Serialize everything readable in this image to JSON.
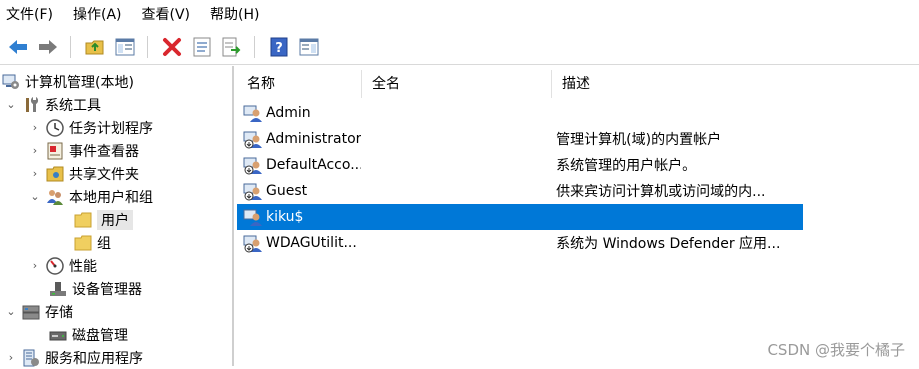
{
  "menu": [
    "文件(F)",
    "操作(A)",
    "查看(V)",
    "帮助(H)"
  ],
  "toolbar": [
    "back-icon",
    "forward-icon",
    "up-folder-icon",
    "show-hide-tree-icon",
    "delete-icon",
    "properties-icon",
    "export-list-icon",
    "help-icon",
    "view-pane-icon"
  ],
  "tree": {
    "root": "计算机管理(本地)",
    "system_tools": "系统工具",
    "task_scheduler": "任务计划程序",
    "event_viewer": "事件查看器",
    "shared_folders": "共享文件夹",
    "local_users_groups": "本地用户和组",
    "users": "用户",
    "groups": "组",
    "performance": "性能",
    "device_manager": "设备管理器",
    "storage": "存储",
    "disk_management": "磁盘管理",
    "services_apps": "服务和应用程序"
  },
  "columns": {
    "name": "名称",
    "fullname": "全名",
    "description": "描述"
  },
  "rows": [
    {
      "name": "Admin",
      "fullname": "",
      "description": ""
    },
    {
      "name": "Administrator",
      "fullname": "",
      "description": "管理计算机(域)的内置帐户"
    },
    {
      "name": "DefaultAcco...",
      "fullname": "",
      "description": "系统管理的用户帐户。"
    },
    {
      "name": "Guest",
      "fullname": "",
      "description": "供来宾访问计算机或访问域的内..."
    },
    {
      "name": "kiku$",
      "fullname": "",
      "description": ""
    },
    {
      "name": "WDAGUtilit...",
      "fullname": "",
      "description": "系统为 Windows Defender 应用..."
    }
  ],
  "selected_row": "kiku$",
  "watermark": "CSDN @我要个橘子",
  "colors": {
    "selection": "#0078d7",
    "tree_selected": "#e6e6e6"
  }
}
